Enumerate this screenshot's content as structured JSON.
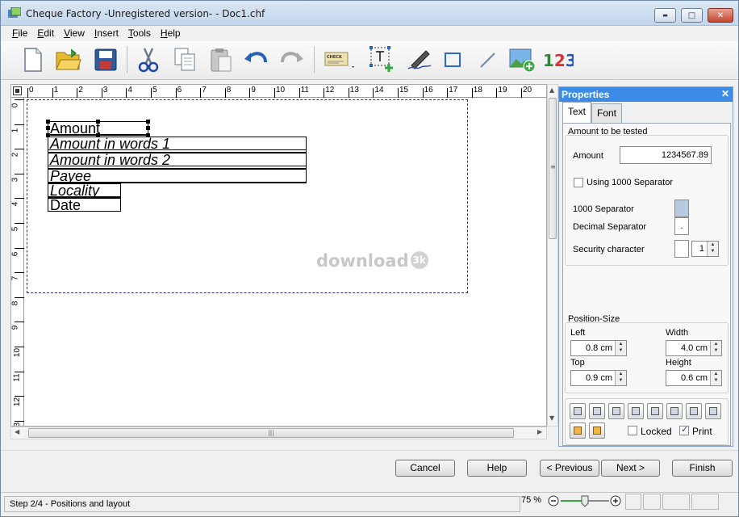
{
  "window": {
    "title": "Cheque Factory -Unregistered version- - Doc1.chf",
    "minimize_symbol": "▬",
    "maximize_symbol": "□",
    "close_symbol": "✕"
  },
  "menu": [
    {
      "label": "File",
      "mnemonic": "F"
    },
    {
      "label": "Edit",
      "mnemonic": "E"
    },
    {
      "label": "View",
      "mnemonic": "V"
    },
    {
      "label": "Insert",
      "mnemonic": "I"
    },
    {
      "label": "Tools",
      "mnemonic": "T"
    },
    {
      "label": "Help",
      "mnemonic": "H"
    }
  ],
  "toolbar": {
    "icons": [
      "new-document-icon",
      "open-folder-icon",
      "save-icon",
      "cut-icon",
      "copy-icon",
      "paste-icon",
      "undo-icon",
      "redo-icon",
      "cheque-template-icon",
      "insert-text-icon",
      "signature-icon",
      "rectangle-icon",
      "line-icon",
      "image-icon",
      "numbers-icon"
    ],
    "cheque_label": "CHECK",
    "numbers_text": "123",
    "numbers_colors": [
      "#2a8a3a",
      "#e03030",
      "#2a5ab8"
    ]
  },
  "ruler": {
    "h_labels": [
      "0",
      "1",
      "2",
      "3",
      "4",
      "5",
      "6",
      "7",
      "8",
      "9",
      "10",
      "11",
      "12",
      "13",
      "14",
      "15",
      "16",
      "17",
      "18",
      "19",
      "20",
      "2"
    ],
    "v_labels": [
      "0",
      "1",
      "2",
      "3",
      "4",
      "5",
      "6",
      "7",
      "8",
      "9",
      "10",
      "11",
      "12",
      "13"
    ]
  },
  "cheque_fields": [
    {
      "text": "Amount",
      "italic": false
    },
    {
      "text": "Amount in words 1",
      "italic": true
    },
    {
      "text": "Amount in words 2",
      "italic": true
    },
    {
      "text": "Payee",
      "italic": true
    },
    {
      "text": "Locality",
      "italic": true
    },
    {
      "text": "Date",
      "italic": false
    }
  ],
  "watermark": {
    "text": "download",
    "badge": "3k"
  },
  "scroll": {
    "grip": "≡",
    "hgrip": "|||"
  },
  "properties": {
    "title": "Properties",
    "close": "✕",
    "tabs": [
      "Text",
      "Font"
    ],
    "active_tab": "Text",
    "amount_group": "Amount to be tested",
    "amount_label": "Amount",
    "amount_value": "1234567.89",
    "use_separator_label": "Using 1000 Separator",
    "use_separator_checked": false,
    "thousand_sep_label": "1000 Separator",
    "decimal_sep_label": "Decimal Separator",
    "decimal_sep_value": ".",
    "security_label": "Security  character",
    "security_count": "1",
    "possize_group": "Position-Size",
    "left_label": "Left",
    "left_value": "0.8 cm",
    "width_label": "Width",
    "width_value": "4.0 cm",
    "top_label": "Top",
    "top_value": "0.9 cm",
    "height_label": "Height",
    "height_value": "0.6 cm",
    "locked_label": "Locked",
    "locked_checked": false,
    "print_label": "Print",
    "print_checked": true
  },
  "buttons": {
    "cancel": "Cancel",
    "help": "Help",
    "previous": "< Previous",
    "next": "Next >",
    "finish": "Finish"
  },
  "status": {
    "text": "Step 2/4 - Positions and layout",
    "zoom": "75 %",
    "zoom_level": 0.5
  }
}
